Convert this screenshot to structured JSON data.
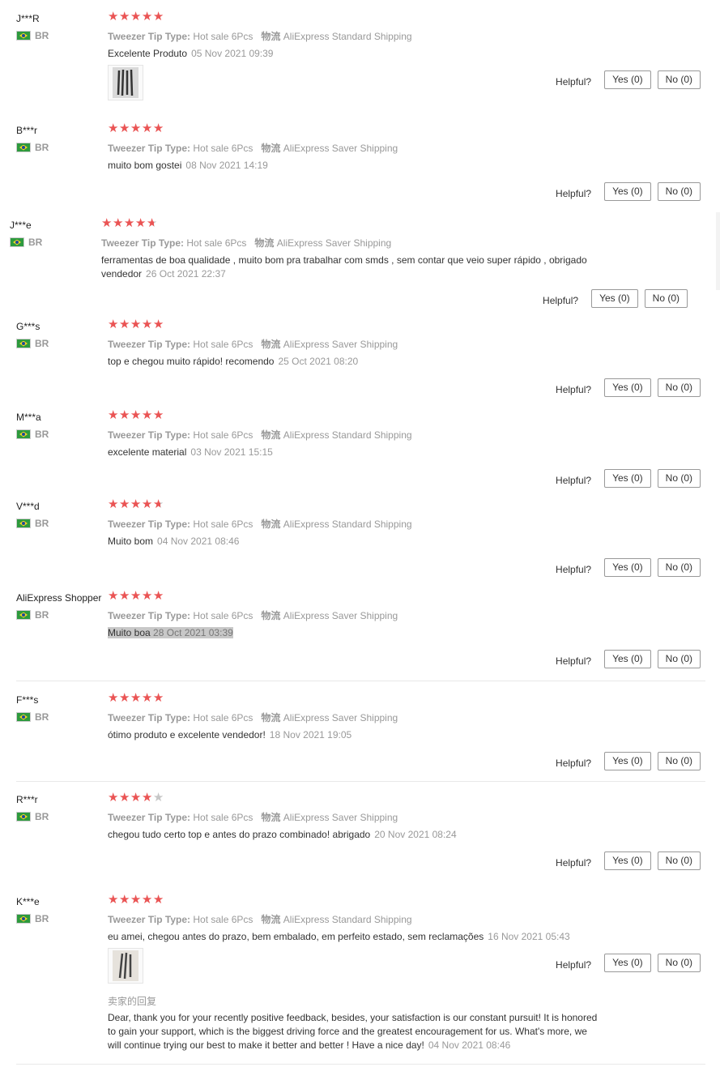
{
  "labels": {
    "tip_type": "Tweezer Tip Type:",
    "logistics": "物流",
    "helpful": "Helpful?",
    "yes": "Yes (0)",
    "no": "No (0)",
    "seller_reply_title": "卖家的回复"
  },
  "colors": {
    "star": "#ea5454",
    "star_empty": "#c6c6c6",
    "muted": "#999999"
  },
  "reviews": [
    {
      "user": "J***R",
      "country": "BR",
      "rating": 5,
      "tip": "Hot sale 6Pcs",
      "shipping": "AliExpress Standard Shipping",
      "text": "Excelente Produto",
      "date": "05 Nov 2021 09:39",
      "photo": "tweezer-photo"
    },
    {
      "user": "B***r",
      "country": "BR",
      "rating": 5,
      "tip": "Hot sale 6Pcs",
      "shipping": "AliExpress Saver Shipping",
      "text": "muito bom gostei",
      "date": "08 Nov 2021 14:19"
    },
    {
      "user": "J***e",
      "country": "BR",
      "rating": 4.8,
      "tip": "Hot sale 6Pcs",
      "shipping": "AliExpress Saver Shipping",
      "text": "ferramentas de boa qualidade , muito bom pra trabalhar com smds , sem contar que veio super rápido , obrigado vendedor",
      "date": "26 Oct 2021 22:37"
    },
    {
      "user": "G***s",
      "country": "BR",
      "rating": 5,
      "tip": "Hot sale 6Pcs",
      "shipping": "AliExpress Saver Shipping",
      "text": "top e chegou muito rápido! recomendo",
      "date": "25 Oct 2021 08:20"
    },
    {
      "user": "M***a",
      "country": "BR",
      "rating": 5,
      "tip": "Hot sale 6Pcs",
      "shipping": "AliExpress Standard Shipping",
      "text": "excelente material",
      "date": "03 Nov 2021 15:15"
    },
    {
      "user": "V***d",
      "country": "BR",
      "rating": 4.8,
      "tip": "Hot sale 6Pcs",
      "shipping": "AliExpress Standard Shipping",
      "text": "Muito bom",
      "date": "04 Nov 2021 08:46"
    },
    {
      "user": "AliExpress Shopper",
      "country": "BR",
      "rating": 5,
      "tip": "Hot sale 6Pcs",
      "shipping": "AliExpress Saver Shipping",
      "text": "Muito boa",
      "date": "28 Oct 2021 03:39"
    },
    {
      "user": "F***s",
      "country": "BR",
      "rating": 5,
      "tip": "Hot sale 6Pcs",
      "shipping": "AliExpress Saver Shipping",
      "text": "ótimo produto e excelente vendedor!",
      "date": "18 Nov 2021 19:05"
    },
    {
      "user": "R***r",
      "country": "BR",
      "rating": 4,
      "tip": "Hot sale 6Pcs",
      "shipping": "AliExpress Saver Shipping",
      "text": "chegou tudo certo top e antes do prazo combinado! abrigado",
      "date": "20 Nov 2021 08:24"
    },
    {
      "user": "K***e",
      "country": "BR",
      "rating": 5,
      "tip": "Hot sale 6Pcs",
      "shipping": "AliExpress Standard Shipping",
      "text": "eu amei, chegou antes do prazo, bem embalado, em perfeito estado, sem reclamações",
      "date": "16 Nov 2021 05:43",
      "photo": "tweezer-photo",
      "seller_reply": "Dear, thank you for your recently positive feedback, besides, your satisfaction is our constant pursuit! It is honored to gain your support, which is the biggest driving force and the greatest encouragement for us. What's more, we will continue trying our best to make it better and better ! Have a nice day!",
      "seller_reply_date": "04 Nov 2021 08:46"
    }
  ]
}
